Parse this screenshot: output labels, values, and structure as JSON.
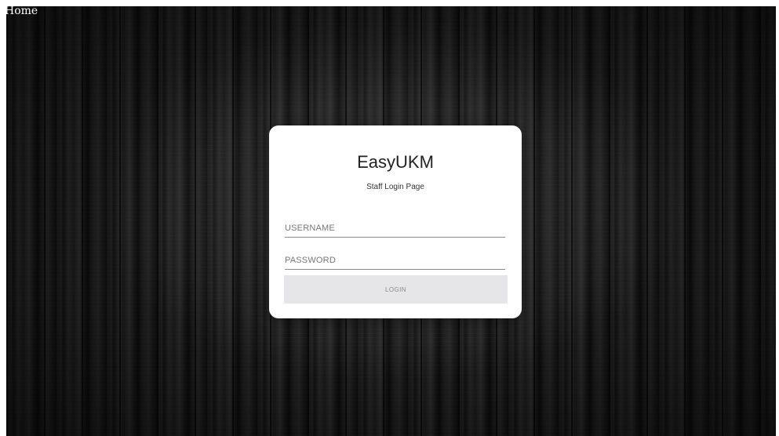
{
  "nav": {
    "home_label": "Home"
  },
  "login": {
    "title": "EasyUKM",
    "subtitle": "Staff Login Page",
    "username_placeholder": "USERNAME",
    "username_value": "",
    "password_placeholder": "PASSWORD",
    "password_value": "",
    "submit_label": "LOGIN"
  },
  "colors": {
    "background": "#161616",
    "card": "#ffffff",
    "button": "#e6e6e8",
    "button_text": "#888888"
  },
  "icons": {
    "background_texture": "dark-wood-planks"
  }
}
